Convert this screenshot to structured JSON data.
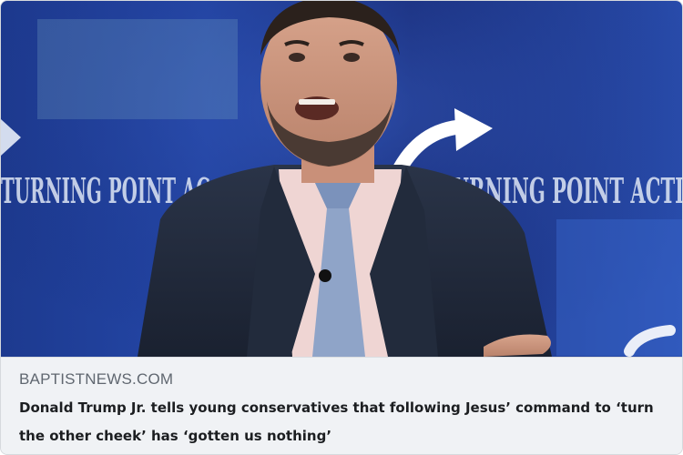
{
  "link_preview": {
    "image_alt": "",
    "backdrop_text_left": "TURNING POINT AC",
    "backdrop_text_right": "TURNING POINT ACTI",
    "source_domain": "BAPTISTNEWS.COM",
    "headline": "Donald Trump Jr. tells young conservatives that following Jesus’ command to ‘turn the other cheek’ has ‘gotten us nothing’"
  },
  "colors": {
    "backdrop_blue": "#2447a8",
    "meta_background": "#f0f2f5",
    "source_gray": "#606770",
    "headline_dark": "#1c1e21"
  }
}
